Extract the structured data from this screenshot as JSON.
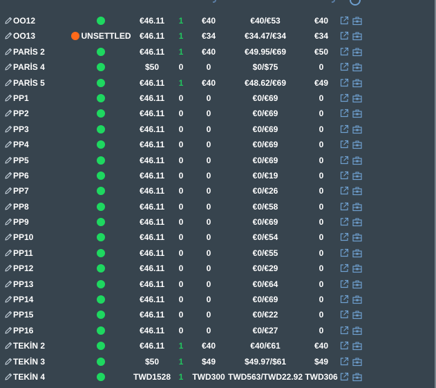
{
  "colors": {
    "background": "#37444e",
    "text": "#ffffff",
    "status_ok": "#1ed860",
    "status_unsettled": "#ff6a1a",
    "qty_positive": "#22c55e",
    "icon_blue": "#6fa0d0"
  },
  "rows": [
    {
      "name": "OO12",
      "status": "ok",
      "status_label": "",
      "price": "€46.11",
      "qty": "1",
      "amount": "€40",
      "ratio": "€40/€53",
      "total": "€40"
    },
    {
      "name": "OO13",
      "status": "unsettled",
      "status_label": "UNSETTLED",
      "price": "€46.11",
      "qty": "1",
      "amount": "€34",
      "ratio": "€34.47/€34",
      "total": "€34"
    },
    {
      "name": "PARİS 2",
      "status": "ok",
      "status_label": "",
      "price": "€46.11",
      "qty": "1",
      "amount": "€40",
      "ratio": "€49.95/€69",
      "total": "€50"
    },
    {
      "name": "PARİS 4",
      "status": "ok",
      "status_label": "",
      "price": "$50",
      "qty": "0",
      "amount": "0",
      "ratio": "$0/$75",
      "total": "0"
    },
    {
      "name": "PARİS 5",
      "status": "ok",
      "status_label": "",
      "price": "€46.11",
      "qty": "1",
      "amount": "€40",
      "ratio": "€48.62/€69",
      "total": "€49"
    },
    {
      "name": "PP1",
      "status": "ok",
      "status_label": "",
      "price": "€46.11",
      "qty": "0",
      "amount": "0",
      "ratio": "€0/€69",
      "total": "0"
    },
    {
      "name": "PP2",
      "status": "ok",
      "status_label": "",
      "price": "€46.11",
      "qty": "0",
      "amount": "0",
      "ratio": "€0/€69",
      "total": "0"
    },
    {
      "name": "PP3",
      "status": "ok",
      "status_label": "",
      "price": "€46.11",
      "qty": "0",
      "amount": "0",
      "ratio": "€0/€69",
      "total": "0"
    },
    {
      "name": "PP4",
      "status": "ok",
      "status_label": "",
      "price": "€46.11",
      "qty": "0",
      "amount": "0",
      "ratio": "€0/€69",
      "total": "0"
    },
    {
      "name": "PP5",
      "status": "ok",
      "status_label": "",
      "price": "€46.11",
      "qty": "0",
      "amount": "0",
      "ratio": "€0/€69",
      "total": "0"
    },
    {
      "name": "PP6",
      "status": "ok",
      "status_label": "",
      "price": "€46.11",
      "qty": "0",
      "amount": "0",
      "ratio": "€0/€19",
      "total": "0"
    },
    {
      "name": "PP7",
      "status": "ok",
      "status_label": "",
      "price": "€46.11",
      "qty": "0",
      "amount": "0",
      "ratio": "€0/€26",
      "total": "0"
    },
    {
      "name": "PP8",
      "status": "ok",
      "status_label": "",
      "price": "€46.11",
      "qty": "0",
      "amount": "0",
      "ratio": "€0/€58",
      "total": "0"
    },
    {
      "name": "PP9",
      "status": "ok",
      "status_label": "",
      "price": "€46.11",
      "qty": "0",
      "amount": "0",
      "ratio": "€0/€69",
      "total": "0"
    },
    {
      "name": "PP10",
      "status": "ok",
      "status_label": "",
      "price": "€46.11",
      "qty": "0",
      "amount": "0",
      "ratio": "€0/€54",
      "total": "0"
    },
    {
      "name": "PP11",
      "status": "ok",
      "status_label": "",
      "price": "€46.11",
      "qty": "0",
      "amount": "0",
      "ratio": "€0/€55",
      "total": "0"
    },
    {
      "name": "PP12",
      "status": "ok",
      "status_label": "",
      "price": "€46.11",
      "qty": "0",
      "amount": "0",
      "ratio": "€0/€29",
      "total": "0"
    },
    {
      "name": "PP13",
      "status": "ok",
      "status_label": "",
      "price": "€46.11",
      "qty": "0",
      "amount": "0",
      "ratio": "€0/€64",
      "total": "0"
    },
    {
      "name": "PP14",
      "status": "ok",
      "status_label": "",
      "price": "€46.11",
      "qty": "0",
      "amount": "0",
      "ratio": "€0/€69",
      "total": "0"
    },
    {
      "name": "PP15",
      "status": "ok",
      "status_label": "",
      "price": "€46.11",
      "qty": "0",
      "amount": "0",
      "ratio": "€0/€22",
      "total": "0"
    },
    {
      "name": "PP16",
      "status": "ok",
      "status_label": "",
      "price": "€46.11",
      "qty": "0",
      "amount": "0",
      "ratio": "€0/€27",
      "total": "0"
    },
    {
      "name": "TEKİN 2",
      "status": "ok",
      "status_label": "",
      "price": "€46.11",
      "qty": "1",
      "amount": "€40",
      "ratio": "€40/€61",
      "total": "€40"
    },
    {
      "name": "TEKİN 3",
      "status": "ok",
      "status_label": "",
      "price": "$50",
      "qty": "1",
      "amount": "$49",
      "ratio": "$49.97/$61",
      "total": "$49"
    },
    {
      "name": "TEKİN 4",
      "status": "ok",
      "status_label": "",
      "price": "TWD1528",
      "qty": "1",
      "amount": "TWD300",
      "ratio": "TWD563/TWD22.92",
      "total": "TWD306"
    }
  ]
}
